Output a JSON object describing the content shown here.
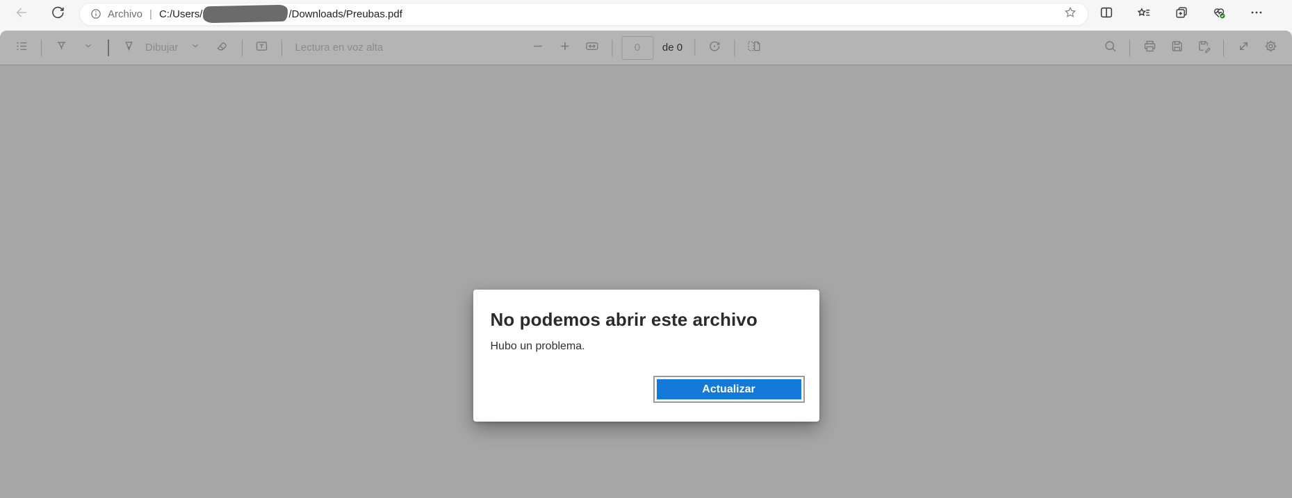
{
  "browser": {
    "address_bar": {
      "scheme_label": "Archivo",
      "separator": "|",
      "path_before_redaction": "C:/Users/",
      "path_after_redaction": "/Downloads/Preubas.pdf"
    },
    "icons": [
      "back-icon",
      "refresh-icon",
      "info-icon",
      "favorite-star-icon",
      "split-screen-icon",
      "favorites-icon",
      "collections-icon",
      "browser-essentials-icon",
      "more-icon"
    ]
  },
  "pdf_toolbar": {
    "draw_label": "Dibujar",
    "read_aloud_label": "Lectura en voz alta",
    "page_number_value": "0",
    "page_count_label": "de 0",
    "icons": [
      "table-of-contents-icon",
      "highlighter-icon",
      "chevron-down-icon",
      "pen-icon",
      "eraser-icon",
      "add-text-icon",
      "zoom-out-icon",
      "zoom-in-icon",
      "fit-to-width-icon",
      "rotate-icon",
      "page-view-icon",
      "search-icon",
      "print-icon",
      "save-icon",
      "save-as-icon",
      "fullscreen-icon",
      "settings-gear-icon"
    ]
  },
  "error_dialog": {
    "title": "No podemos abrir este archivo",
    "message": "Hubo un problema.",
    "refresh_button_label": "Actualizar"
  },
  "colors": {
    "accent_blue": "#1379d8",
    "toolbar_bg": "#b4b4b4",
    "content_bg": "#a6a6a6",
    "chrome_bg": "#f6f6f6",
    "essentials_badge_green": "#1c7c1c"
  }
}
